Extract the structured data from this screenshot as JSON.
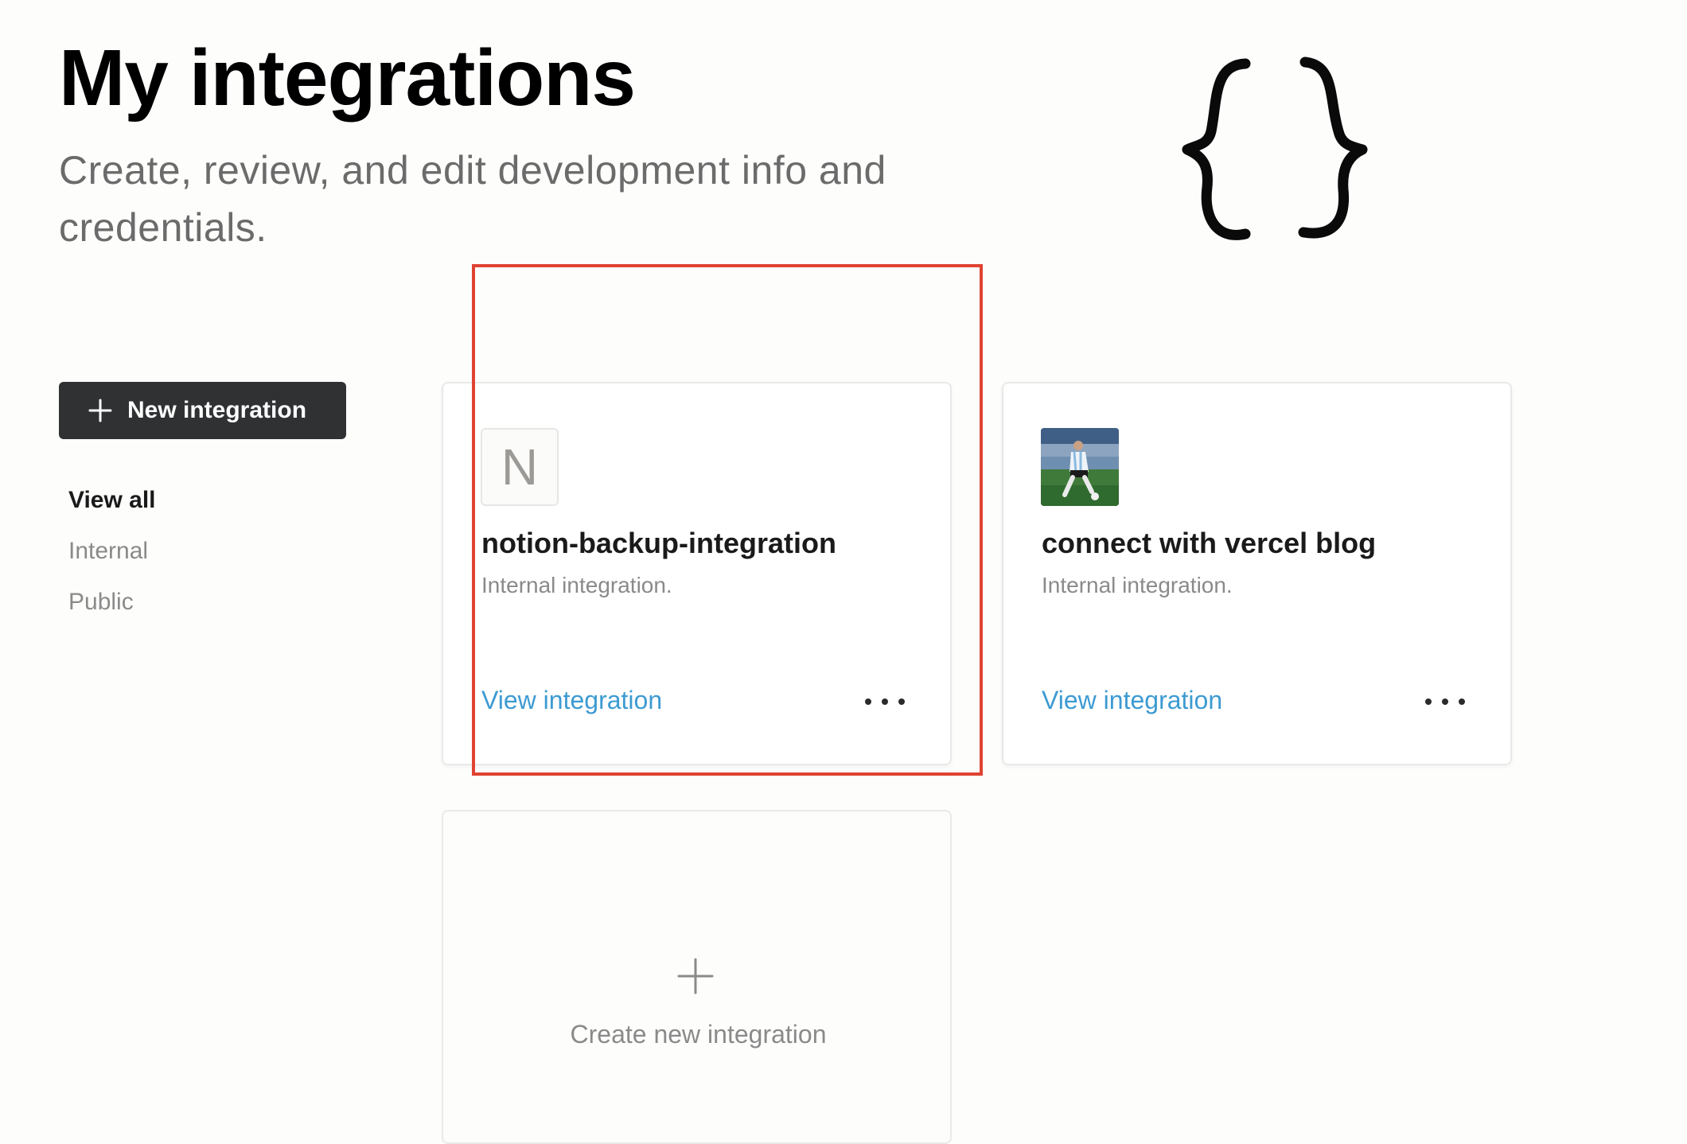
{
  "header": {
    "title": "My integrations",
    "subtitle": "Create, review, and edit development info and credentials.",
    "illustration_icon": "curly-braces-icon"
  },
  "sidebar": {
    "new_button_label": "New integration",
    "new_button_icon": "plus-icon",
    "filters": [
      {
        "label": "View all",
        "active": true
      },
      {
        "label": "Internal",
        "active": false
      },
      {
        "label": "Public",
        "active": false
      }
    ]
  },
  "integrations": [
    {
      "name": "notion-backup-integration",
      "type_label": "Internal integration.",
      "icon_letter": "N",
      "icon": "letter-avatar-icon",
      "link_label": "View integration",
      "more_icon": "more-horizontal-icon"
    },
    {
      "name": "connect with vercel blog",
      "type_label": "Internal integration.",
      "icon": "soccer-player-photo",
      "link_label": "View integration",
      "more_icon": "more-horizontal-icon"
    }
  ],
  "create_card": {
    "label": "Create new integration",
    "icon": "plus-icon"
  },
  "colors": {
    "background": "#fdfdfc",
    "button_bg": "#2f3133",
    "link": "#3d9bd2",
    "highlight": "#e04332",
    "muted_text": "#8a8a8a"
  }
}
